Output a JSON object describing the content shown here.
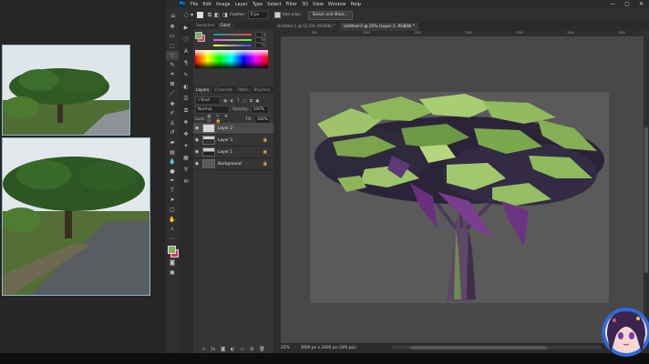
{
  "menubar": {
    "logo": "Ps",
    "items": [
      "File",
      "Edit",
      "Image",
      "Layer",
      "Type",
      "Select",
      "Filter",
      "3D",
      "View",
      "Window",
      "Help"
    ],
    "window_controls": [
      "—",
      "▢",
      "✕"
    ]
  },
  "options": {
    "feather_label": "Feather:",
    "feather_value": "0 px",
    "antialias_label": "Anti-alias",
    "select_mask_label": "Select and Mask..."
  },
  "panels": {
    "color_tabs": [
      "Swatches",
      "Color"
    ],
    "color_active": "Color",
    "slider_values": [
      "74",
      "93",
      "71"
    ],
    "layer_tabs": [
      "Layers",
      "Channels",
      "Paths",
      "Brushes"
    ],
    "layers_active": "Layers",
    "filter_kind": "Kind",
    "blend_mode": "Normal",
    "opacity_label": "Opacity:",
    "opacity_value": "100%",
    "lock_label": "Lock:",
    "fill_label": "Fill:",
    "fill_value": "100%",
    "layers": [
      {
        "name": "Layer 2",
        "selected": true
      },
      {
        "name": "Layer 3",
        "selected": false
      },
      {
        "name": "Layer 1",
        "selected": false
      },
      {
        "name": "Background",
        "selected": false
      }
    ]
  },
  "documents": {
    "tabs": [
      {
        "title": "Untitled-1 @ 12.5% (RGB/8) *",
        "active": false
      },
      {
        "title": "Untitled-2 @ 25% (Layer 2, RGB/8) *",
        "active": true
      }
    ],
    "ruler_ticks": [
      "",
      "500",
      "",
      "1000",
      "",
      "1500",
      "",
      "2000",
      "",
      "2500",
      "",
      "3000",
      "",
      "3500"
    ]
  },
  "status": {
    "zoom": "25%",
    "doc_size": "3000 px x 2400 px (300 ppi)"
  },
  "colors": {
    "foreground": "#7fae5d",
    "background": "#d6395a",
    "accent": "#31a8ff"
  },
  "icons": {
    "tools": [
      "move-icon",
      "artboard-icon",
      "marquee-icon",
      "lasso-icon",
      "quick-select-icon",
      "crop-icon",
      "frame-icon",
      "eyedropper-icon",
      "heal-icon",
      "brush-icon",
      "stamp-icon",
      "history-brush-icon",
      "eraser-icon",
      "gradient-icon",
      "blur-icon",
      "dodge-icon",
      "pen-icon",
      "type-icon",
      "path-select-icon",
      "shape-icon",
      "hand-icon",
      "zoom-icon",
      "more-icon"
    ]
  }
}
